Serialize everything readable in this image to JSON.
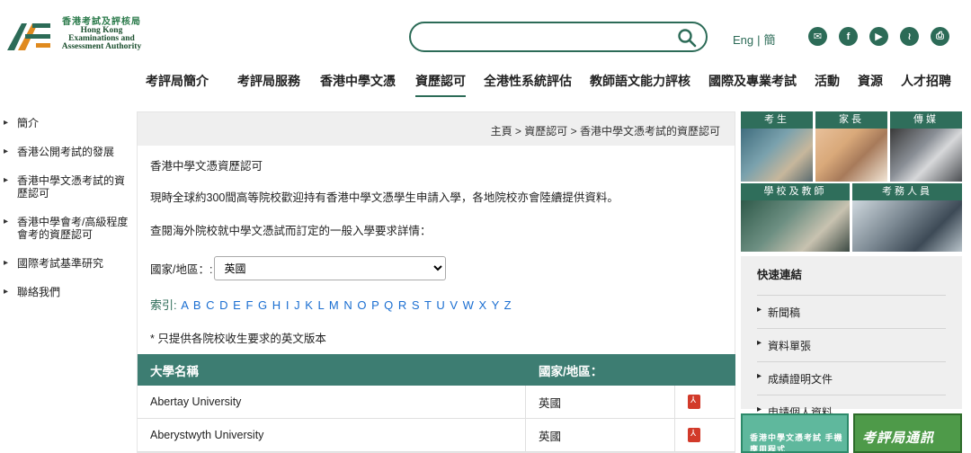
{
  "header": {
    "logo": {
      "cn": "香港考試及評核局",
      "en_line1": "Hong Kong",
      "en_line2": "Examinations and",
      "en_line3": "Assessment Authority"
    },
    "search": {
      "value": "",
      "placeholder": ""
    },
    "lang": {
      "en": "Eng",
      "sep": "|",
      "sc": "簡"
    },
    "social_icons": [
      "email-icon",
      "facebook-icon",
      "youtube-icon",
      "rss-icon",
      "print-icon"
    ]
  },
  "topnav": {
    "items": [
      {
        "label": "考評局簡介"
      },
      {
        "label": "考評局服務"
      },
      {
        "label": "香港中學文憑"
      },
      {
        "label": "資歷認可",
        "active": true
      },
      {
        "label": "全港性系統評估"
      },
      {
        "label": "教師語文能力評核"
      },
      {
        "label": "國際及專業考試"
      },
      {
        "label": "活動"
      },
      {
        "label": "資源"
      },
      {
        "label": "人才招聘"
      }
    ]
  },
  "sidebar": {
    "items": [
      {
        "label": "簡介"
      },
      {
        "label": "香港公開考試的發展"
      },
      {
        "label": "香港中學文憑考試的資歷認可"
      },
      {
        "label": "香港中學會考/高級程度會考的資歷認可"
      },
      {
        "label": "國際考試基準研究"
      },
      {
        "label": "聯絡我們"
      }
    ]
  },
  "main": {
    "breadcrumb": [
      "主頁",
      "資歷認可",
      "香港中學文憑考試的資歷認可"
    ],
    "breadcrumb_sep": " > ",
    "title": "香港中學文憑資歷認可",
    "para1": "現時全球約300間高等院校歡迎持有香港中學文憑學生申請入學，各地院校亦會陸續提供資料。",
    "para2": "查閱海外院校就中學文憑試而訂定的一般入學要求詳情：",
    "country_label": "國家/地區：:",
    "country_selected": "英國",
    "index_label": "索引:",
    "index_letters": [
      "A",
      "B",
      "C",
      "D",
      "E",
      "F",
      "G",
      "H",
      "I",
      "J",
      "K",
      "L",
      "M",
      "N",
      "O",
      "P",
      "Q",
      "R",
      "S",
      "T",
      "U",
      "V",
      "W",
      "X",
      "Y",
      "Z"
    ],
    "note": "* 只提供各院校收生要求的英文版本",
    "table": {
      "headers": [
        "大學名稱",
        "國家/地區："
      ],
      "rows": [
        {
          "name": "Abertay University",
          "country": "英國"
        },
        {
          "name": "Aberystwyth University",
          "country": "英國"
        }
      ]
    }
  },
  "rightcol": {
    "tiles": [
      "考生",
      "家長",
      "傳媒",
      "學校及教師",
      "考務人員"
    ],
    "quick_links": {
      "title": "快速連結",
      "items": [
        "新聞稿",
        "資料單張",
        "成績證明文件",
        "申請個人資料"
      ]
    },
    "banner1_text": "香港中學文憑考試 手機應用程式",
    "banner2_text": "考評局通訊"
  },
  "colors": {
    "accent": "#2c6b57",
    "table_header": "#3d7d72",
    "link": "#1a6ed1",
    "pdf": "#d23a2a"
  }
}
